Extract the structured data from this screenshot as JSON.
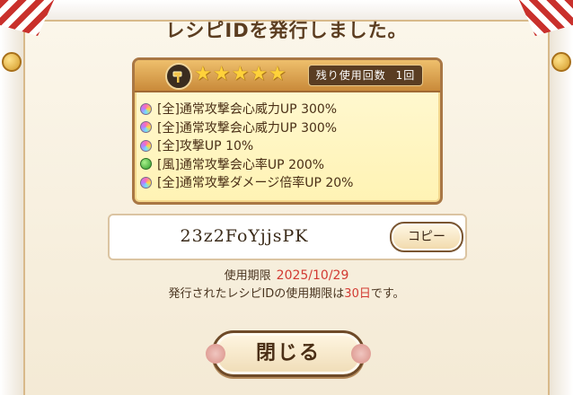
{
  "dialog": {
    "title": "レシピIDを発行しました。"
  },
  "recipe": {
    "icon": "hammer-icon",
    "stars": [
      "★",
      "★",
      "★",
      "★",
      "★"
    ],
    "uses_label": "残り使用回数",
    "uses_count": "1回",
    "effects": [
      {
        "gem": "rainbow",
        "label": "[全]通常攻撃会心威力UP 300%"
      },
      {
        "gem": "rainbow",
        "label": "[全]通常攻撃会心威力UP 300%"
      },
      {
        "gem": "rainbow",
        "label": "[全]攻撃UP 10%"
      },
      {
        "gem": "green",
        "label": "[風]通常攻撃会心率UP 200%"
      },
      {
        "gem": "rainbow",
        "label": "[全]通常攻撃ダメージ倍率UP 20%"
      }
    ]
  },
  "recipe_id": {
    "value": "23z2FoYjjsPK",
    "copy_label": "コピー"
  },
  "expiry": {
    "label": "使用期限",
    "date": "2025/10/29",
    "note_before": "発行されたレシピIDの使用期限は",
    "note_days": "30日",
    "note_after": "です。"
  },
  "close_button": {
    "label": "閉じる"
  },
  "colors": {
    "accent_red": "#d23a32",
    "frame_brown": "#a97744",
    "header_gold": "#c98a3a"
  }
}
